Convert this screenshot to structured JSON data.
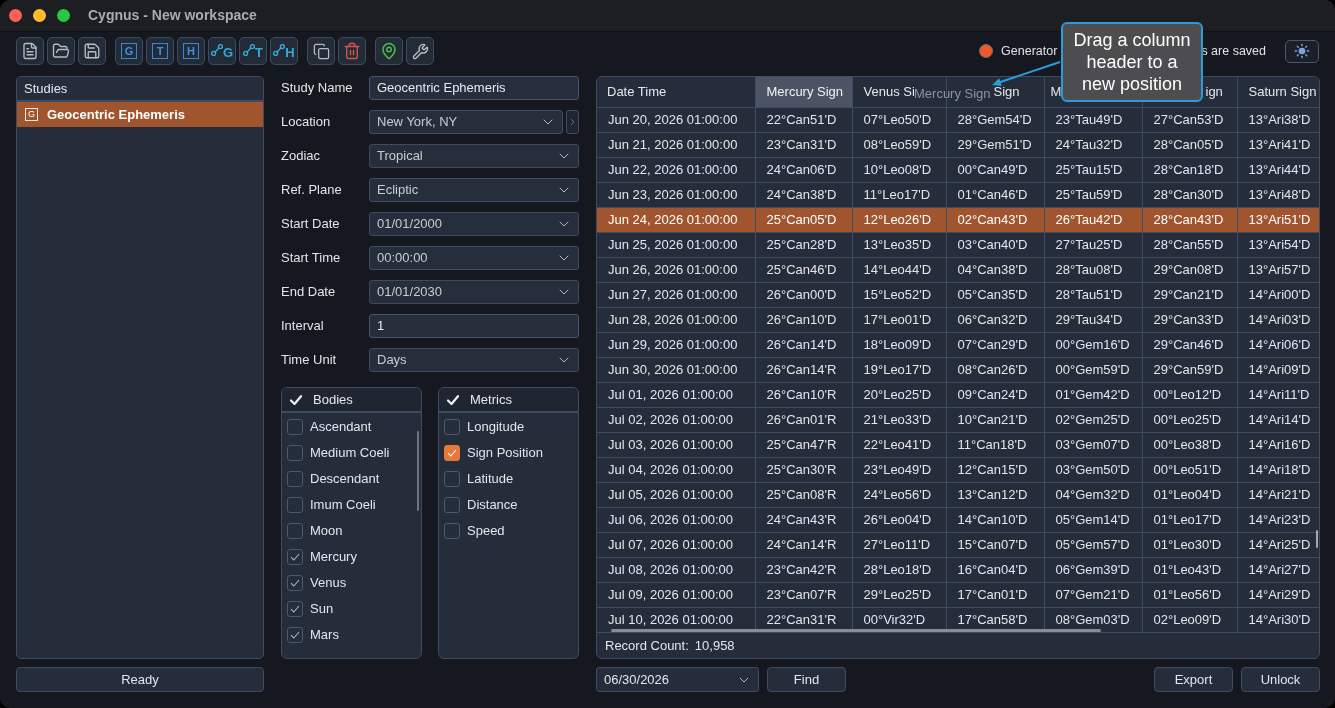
{
  "window": {
    "title": "Cygnus - New workspace"
  },
  "toolbar": {
    "groups": [
      [
        {
          "kind": "new-document"
        },
        {
          "kind": "open-folder"
        },
        {
          "kind": "save"
        }
      ],
      [
        {
          "kind": "letter-box",
          "letter": "G"
        },
        {
          "kind": "letter-box",
          "letter": "T"
        },
        {
          "kind": "letter-box",
          "letter": "H"
        },
        {
          "kind": "graph-letter",
          "letter": "G"
        },
        {
          "kind": "graph-letter",
          "letter": "T"
        },
        {
          "kind": "graph-letter",
          "letter": "H"
        }
      ],
      [
        {
          "kind": "copy"
        },
        {
          "kind": "delete"
        }
      ],
      [
        {
          "kind": "location"
        },
        {
          "kind": "settings"
        }
      ]
    ]
  },
  "status": {
    "color": "#ee5a2c",
    "text_before": "Generator",
    "text_after": "s are saved"
  },
  "tooltip": {
    "text": "Drag a column header to a new position"
  },
  "drag_ghost": {
    "text": "Mercury Sign"
  },
  "studies": {
    "title": "Studies",
    "items": [
      {
        "type_letter": "G",
        "name": "Geocentric Ephemeris",
        "selected": true
      }
    ]
  },
  "status_button": "Ready",
  "form": {
    "fields": [
      {
        "label": "Study Name",
        "kind": "text",
        "value": "Geocentric Ephemeris"
      },
      {
        "label": "Location",
        "kind": "dropdown-nav",
        "value": "New York, NY"
      },
      {
        "label": "Zodiac",
        "kind": "dropdown",
        "value": "Tropical"
      },
      {
        "label": "Ref. Plane",
        "kind": "dropdown",
        "value": "Ecliptic"
      },
      {
        "label": "Start Date",
        "kind": "dropdown",
        "value": "01/01/2000"
      },
      {
        "label": "Start Time",
        "kind": "dropdown",
        "value": "00:00:00"
      },
      {
        "label": "End Date",
        "kind": "dropdown",
        "value": "01/01/2030"
      },
      {
        "label": "Interval",
        "kind": "text",
        "value": "1"
      },
      {
        "label": "Time Unit",
        "kind": "dropdown",
        "value": "Days"
      }
    ]
  },
  "bodies": {
    "title": "Bodies",
    "header_checked": true,
    "items": [
      {
        "label": "Ascendant",
        "checked": false
      },
      {
        "label": "Medium Coeli",
        "checked": false
      },
      {
        "label": "Descendant",
        "checked": false
      },
      {
        "label": "Imum Coeli",
        "checked": false
      },
      {
        "label": "Moon",
        "checked": false
      },
      {
        "label": "Mercury",
        "checked": true
      },
      {
        "label": "Venus",
        "checked": true
      },
      {
        "label": "Sun",
        "checked": true
      },
      {
        "label": "Mars",
        "checked": true
      }
    ]
  },
  "metrics": {
    "title": "Metrics",
    "header_checked": true,
    "items": [
      {
        "label": "Longitude",
        "checked": false,
        "focused": false
      },
      {
        "label": "Sign Position",
        "checked": true,
        "focused": true
      },
      {
        "label": "Latitude",
        "checked": false,
        "focused": false
      },
      {
        "label": "Distance",
        "checked": false,
        "focused": false
      },
      {
        "label": "Speed",
        "checked": false,
        "focused": false
      }
    ]
  },
  "table": {
    "columns": [
      {
        "label": "Date Time",
        "selected": false
      },
      {
        "label": "Mercury Sign",
        "selected": true
      },
      {
        "label": "Venus Si",
        "selected": false
      },
      {
        "label": "Sign",
        "selected": false
      },
      {
        "label": "M",
        "selected": false
      },
      {
        "label": "ign",
        "selected": false
      },
      {
        "label": "Saturn Sign",
        "selected": false
      }
    ],
    "rows": [
      {
        "selected": false,
        "cells": [
          "Jun 20, 2026 01:00:00",
          "22°Can51'D",
          "07°Leo50'D",
          "28°Gem54'D",
          "23°Tau49'D",
          "27°Can53'D",
          "13°Ari38'D"
        ]
      },
      {
        "selected": false,
        "cells": [
          "Jun 21, 2026 01:00:00",
          "23°Can31'D",
          "08°Leo59'D",
          "29°Gem51'D",
          "24°Tau32'D",
          "28°Can05'D",
          "13°Ari41'D"
        ]
      },
      {
        "selected": false,
        "cells": [
          "Jun 22, 2026 01:00:00",
          "24°Can06'D",
          "10°Leo08'D",
          "00°Can49'D",
          "25°Tau15'D",
          "28°Can18'D",
          "13°Ari44'D"
        ]
      },
      {
        "selected": false,
        "cells": [
          "Jun 23, 2026 01:00:00",
          "24°Can38'D",
          "11°Leo17'D",
          "01°Can46'D",
          "25°Tau59'D",
          "28°Can30'D",
          "13°Ari48'D"
        ]
      },
      {
        "selected": true,
        "cells": [
          "Jun 24, 2026 01:00:00",
          "25°Can05'D",
          "12°Leo26'D",
          "02°Can43'D",
          "26°Tau42'D",
          "28°Can43'D",
          "13°Ari51'D"
        ]
      },
      {
        "selected": false,
        "cells": [
          "Jun 25, 2026 01:00:00",
          "25°Can28'D",
          "13°Leo35'D",
          "03°Can40'D",
          "27°Tau25'D",
          "28°Can55'D",
          "13°Ari54'D"
        ]
      },
      {
        "selected": false,
        "cells": [
          "Jun 26, 2026 01:00:00",
          "25°Can46'D",
          "14°Leo44'D",
          "04°Can38'D",
          "28°Tau08'D",
          "29°Can08'D",
          "13°Ari57'D"
        ]
      },
      {
        "selected": false,
        "cells": [
          "Jun 27, 2026 01:00:00",
          "26°Can00'D",
          "15°Leo52'D",
          "05°Can35'D",
          "28°Tau51'D",
          "29°Can21'D",
          "14°Ari00'D"
        ]
      },
      {
        "selected": false,
        "cells": [
          "Jun 28, 2026 01:00:00",
          "26°Can10'D",
          "17°Leo01'D",
          "06°Can32'D",
          "29°Tau34'D",
          "29°Can33'D",
          "14°Ari03'D"
        ]
      },
      {
        "selected": false,
        "cells": [
          "Jun 29, 2026 01:00:00",
          "26°Can14'D",
          "18°Leo09'D",
          "07°Can29'D",
          "00°Gem16'D",
          "29°Can46'D",
          "14°Ari06'D"
        ]
      },
      {
        "selected": false,
        "cells": [
          "Jun 30, 2026 01:00:00",
          "26°Can14'R",
          "19°Leo17'D",
          "08°Can26'D",
          "00°Gem59'D",
          "29°Can59'D",
          "14°Ari09'D"
        ]
      },
      {
        "selected": false,
        "cells": [
          "Jul 01, 2026 01:00:00",
          "26°Can10'R",
          "20°Leo25'D",
          "09°Can24'D",
          "01°Gem42'D",
          "00°Leo12'D",
          "14°Ari11'D"
        ]
      },
      {
        "selected": false,
        "cells": [
          "Jul 02, 2026 01:00:00",
          "26°Can01'R",
          "21°Leo33'D",
          "10°Can21'D",
          "02°Gem25'D",
          "00°Leo25'D",
          "14°Ari14'D"
        ]
      },
      {
        "selected": false,
        "cells": [
          "Jul 03, 2026 01:00:00",
          "25°Can47'R",
          "22°Leo41'D",
          "11°Can18'D",
          "03°Gem07'D",
          "00°Leo38'D",
          "14°Ari16'D"
        ]
      },
      {
        "selected": false,
        "cells": [
          "Jul 04, 2026 01:00:00",
          "25°Can30'R",
          "23°Leo49'D",
          "12°Can15'D",
          "03°Gem50'D",
          "00°Leo51'D",
          "14°Ari18'D"
        ]
      },
      {
        "selected": false,
        "cells": [
          "Jul 05, 2026 01:00:00",
          "25°Can08'R",
          "24°Leo56'D",
          "13°Can12'D",
          "04°Gem32'D",
          "01°Leo04'D",
          "14°Ari21'D"
        ]
      },
      {
        "selected": false,
        "cells": [
          "Jul 06, 2026 01:00:00",
          "24°Can43'R",
          "26°Leo04'D",
          "14°Can10'D",
          "05°Gem14'D",
          "01°Leo17'D",
          "14°Ari23'D"
        ]
      },
      {
        "selected": false,
        "cells": [
          "Jul 07, 2026 01:00:00",
          "24°Can14'R",
          "27°Leo11'D",
          "15°Can07'D",
          "05°Gem57'D",
          "01°Leo30'D",
          "14°Ari25'D"
        ]
      },
      {
        "selected": false,
        "cells": [
          "Jul 08, 2026 01:00:00",
          "23°Can42'R",
          "28°Leo18'D",
          "16°Can04'D",
          "06°Gem39'D",
          "01°Leo43'D",
          "14°Ari27'D"
        ]
      },
      {
        "selected": false,
        "cells": [
          "Jul 09, 2026 01:00:00",
          "23°Can07'R",
          "29°Leo25'D",
          "17°Can01'D",
          "07°Gem21'D",
          "01°Leo56'D",
          "14°Ari29'D"
        ]
      },
      {
        "selected": false,
        "cells": [
          "Jul 10, 2026 01:00:00",
          "22°Can31'R",
          "00°Vir32'D",
          "17°Can58'D",
          "08°Gem03'D",
          "02°Leo09'D",
          "14°Ari30'D"
        ]
      }
    ],
    "record_count_label": "Record Count:",
    "record_count": "10,958"
  },
  "find": {
    "date": "06/30/2026",
    "button": "Find"
  },
  "buttons": [
    "Export",
    "Unlock"
  ]
}
